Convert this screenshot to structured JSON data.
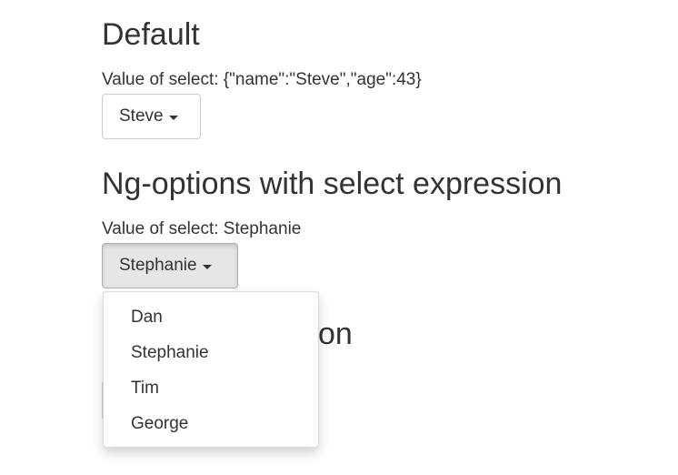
{
  "sections": [
    {
      "title": "Default",
      "value_prefix": "Value of select: ",
      "value": "{\"name\":\"Steve\",\"age\":43}",
      "selected": "Steve"
    },
    {
      "title": "Ng-options with select expression",
      "value_prefix": "Value of select: ",
      "value": "Stephanie",
      "selected": "Stephanie"
    },
    {
      "title_visible_fragment": "on"
    }
  ],
  "dropdown": {
    "options": [
      "Dan",
      "Stephanie",
      "Tim",
      "George"
    ]
  },
  "icons": {
    "caret": "caret-down-icon"
  }
}
